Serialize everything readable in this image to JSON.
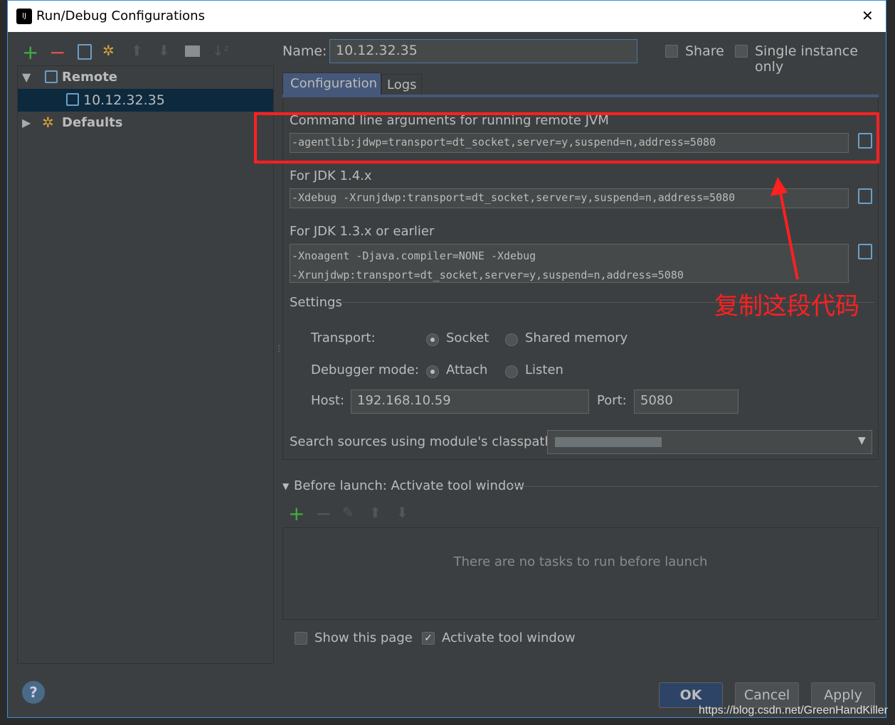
{
  "window": {
    "title": "Run/Debug Configurations",
    "close": "✕"
  },
  "toolbar": {
    "add": "+",
    "remove": "−",
    "copy": "copy-icon",
    "edit_defaults": "wrench-icon",
    "up": "arrow-up-icon",
    "down": "arrow-down-icon",
    "folder": "folder-icon",
    "sort": "sort-icon"
  },
  "tree": [
    {
      "label": "Remote",
      "expanded": true
    },
    {
      "label": "10.12.32.35",
      "selected": true
    },
    {
      "label": "Defaults",
      "expanded": false
    }
  ],
  "name": {
    "label": "Name:",
    "value": "10.12.32.35"
  },
  "share": {
    "label": "Share",
    "checked": false
  },
  "single_instance": {
    "label": "Single instance only",
    "checked": false
  },
  "tabs": [
    {
      "label": "Configuration",
      "active": true
    },
    {
      "label": "Logs"
    }
  ],
  "cmd": {
    "label": "Command line arguments for running remote JVM",
    "value": "-agentlib:jdwp=transport=dt_socket,server=y,suspend=n,address=5080"
  },
  "jdk14": {
    "label": "For JDK 1.4.x",
    "value": "-Xdebug -Xrunjdwp:transport=dt_socket,server=y,suspend=n,address=5080"
  },
  "jdk13": {
    "label": "For JDK 1.3.x or earlier",
    "line1": "-Xnoagent -Djava.compiler=NONE -Xdebug",
    "line2": "-Xrunjdwp:transport=dt_socket,server=y,suspend=n,address=5080"
  },
  "settings": {
    "label": "Settings",
    "transport_label": "Transport:",
    "socket": "Socket",
    "shared_memory": "Shared memory",
    "transport_selected": "Socket",
    "debugger_label": "Debugger mode:",
    "attach": "Attach",
    "listen": "Listen",
    "debugger_selected": "Attach",
    "host_label": "Host:",
    "host": "192.168.10.59",
    "port_label": "Port:",
    "port": "5080",
    "classpath_label": "Search sources using module's classpath:"
  },
  "annotation": {
    "text": "复制这段代码",
    "color": "#ff2020"
  },
  "before_launch": {
    "label": "Before launch: Activate tool window",
    "empty": "There are no tasks to run before launch"
  },
  "show_page": {
    "label": "Show this page",
    "checked": false
  },
  "activate_tool": {
    "label": "Activate tool window",
    "checked": true
  },
  "buttons": {
    "help": "?",
    "ok": "OK",
    "cancel": "Cancel",
    "apply": "Apply"
  },
  "watermark": "https://blog.csdn.net/GreenHandKiller"
}
